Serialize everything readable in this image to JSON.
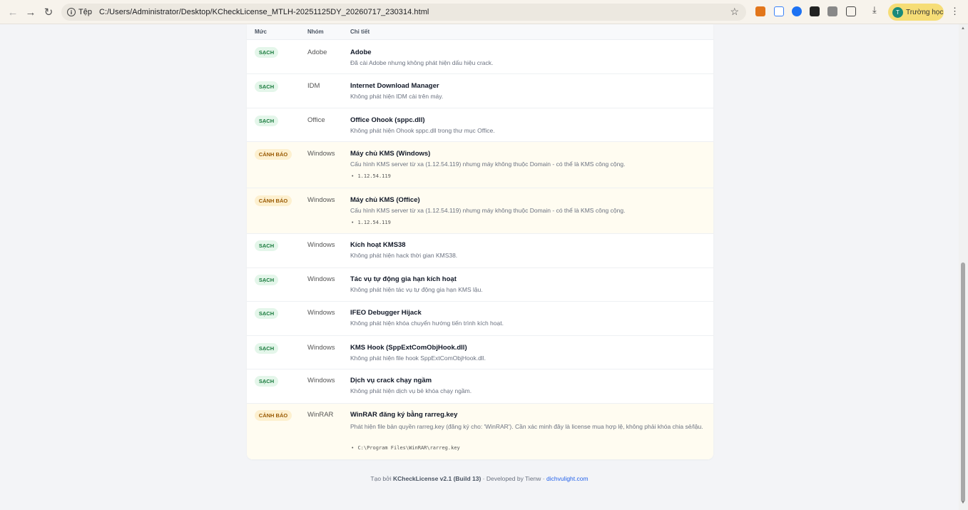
{
  "browser": {
    "scheme": "Tệp",
    "url": "C:/Users/Administrator/Desktop/KCheckLicense_MTLH-20251125DY_20260717_230314.html",
    "profile_name": "Trường học",
    "profile_initial": "T"
  },
  "table": {
    "headers": {
      "level": "Mức",
      "group": "Nhóm",
      "detail": "Chi tiết"
    },
    "rows": [
      {
        "status": "SẠCH",
        "group": "Adobe",
        "title": "Adobe",
        "desc": "Đã cài Adobe nhưng không phát hiện dấu hiệu crack."
      },
      {
        "status": "SẠCH",
        "group": "IDM",
        "title": "Internet Download Manager",
        "desc": "Không phát hiện IDM cài trên máy."
      },
      {
        "status": "SẠCH",
        "group": "Office",
        "title": "Office Ohook (sppc.dll)",
        "desc": "Không phát hiện Ohook sppc.dll trong thư mục Office."
      },
      {
        "status": "CẢNH BÁO",
        "group": "Windows",
        "title": "Máy chủ KMS (Windows)",
        "desc": "Cấu hình KMS server từ xa (1.12.54.119) nhưng máy không thuộc Domain - có thể là KMS công cộng.",
        "evidence": "1.12.54.119"
      },
      {
        "status": "CẢNH BÁO",
        "group": "Windows",
        "title": "Máy chủ KMS (Office)",
        "desc": "Cấu hình KMS server từ xa (1.12.54.119) nhưng máy không thuộc Domain - có thể là KMS công cộng.",
        "evidence": "1.12.54.119"
      },
      {
        "status": "SẠCH",
        "group": "Windows",
        "title": "Kích hoạt KMS38",
        "desc": "Không phát hiện hack thời gian KMS38."
      },
      {
        "status": "SẠCH",
        "group": "Windows",
        "title": "Tác vụ tự động gia hạn kích hoạt",
        "desc": "Không phát hiện tác vụ tự động gia hạn KMS lậu."
      },
      {
        "status": "SẠCH",
        "group": "Windows",
        "title": "IFEO Debugger Hijack",
        "desc": "Không phát hiện khóa chuyển hướng tiến trình kích hoạt."
      },
      {
        "status": "SẠCH",
        "group": "Windows",
        "title": "KMS Hook (SppExtComObjHook.dll)",
        "desc": "Không phát hiện file hook SppExtComObjHook.dll."
      },
      {
        "status": "SẠCH",
        "group": "Windows",
        "title": "Dịch vụ crack chạy ngầm",
        "desc": "Không phát hiện dịch vụ bẻ khóa chạy ngầm."
      },
      {
        "status": "CẢNH BÁO",
        "group": "WinRAR",
        "title": "WinRAR đăng ký bằng rarreg.key",
        "desc": "Phát hiện file bản quyền rarreg.key (đăng ký cho: 'WinRAR'). Cần xác minh đây là license mua hợp lệ, không phải khóa chia sẻ/lậu.",
        "evidence": "C:\\Program Files\\WinRAR\\rarreg.key"
      }
    ]
  },
  "footer": {
    "prefix": "Tạo bởi",
    "product": "KCheckLicense v2.1 (Build 13)",
    "middle": "· Developed by Tienw ·",
    "link": "dichvulight.com"
  }
}
